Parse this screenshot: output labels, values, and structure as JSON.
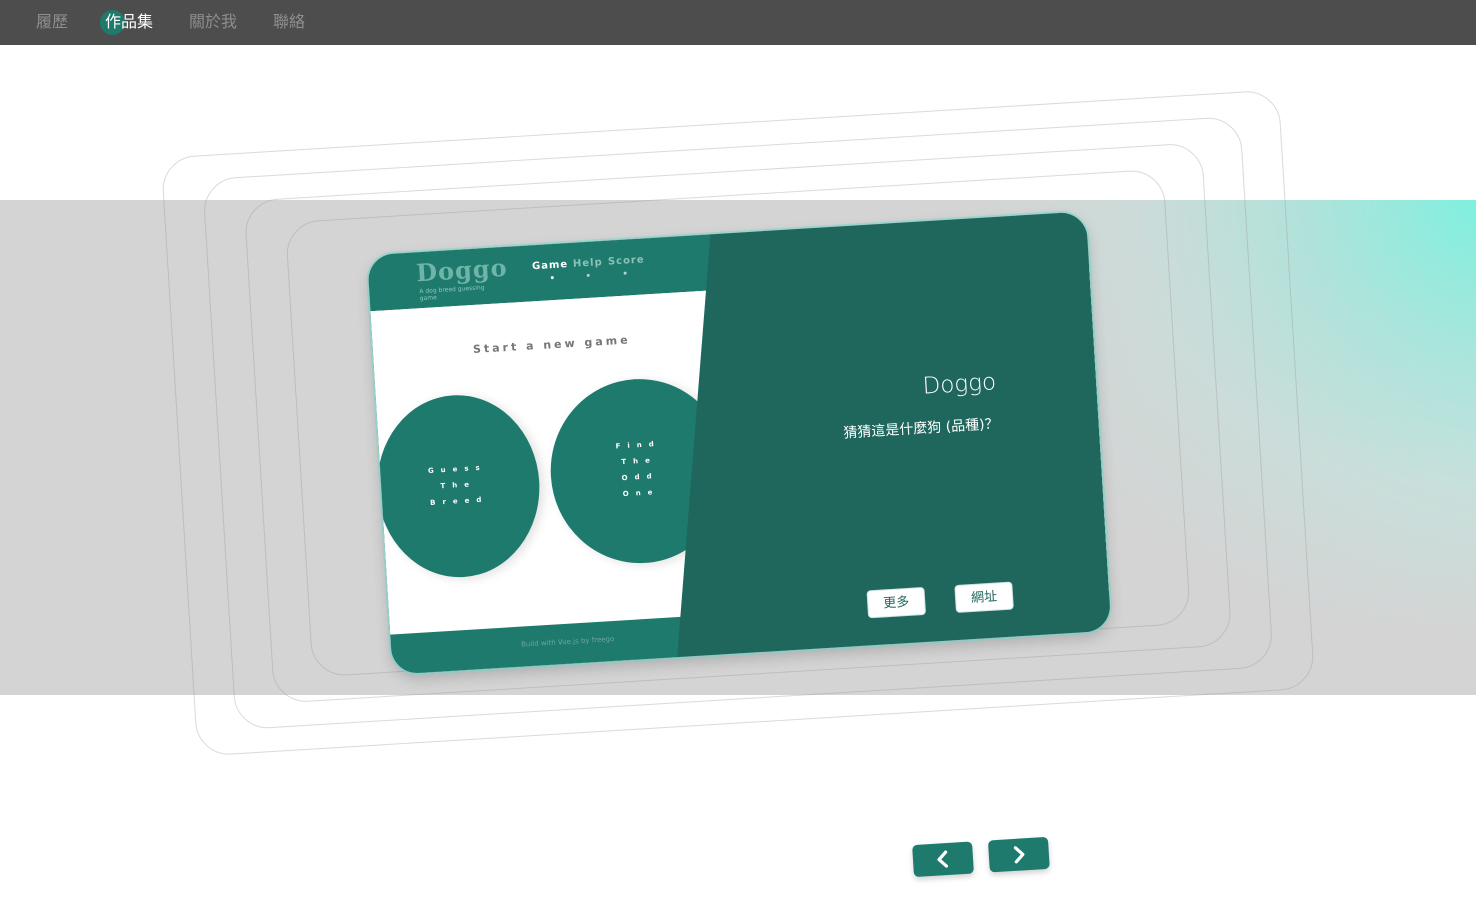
{
  "nav": {
    "items": [
      {
        "label": "履歷"
      },
      {
        "label": "作品集"
      },
      {
        "label": "關於我"
      },
      {
        "label": "聯絡"
      }
    ],
    "active_index": 1
  },
  "project": {
    "title": "Doggo",
    "description": "猜猜這是什麼狗 (品種)？",
    "more_label": "更多",
    "link_label": "網址"
  },
  "preview": {
    "logo": "Doggo",
    "subtitle": "A dog breed guessing game",
    "tabs": [
      "Game",
      "Help",
      "Score"
    ],
    "start_label": "Start a new game",
    "circle_left": [
      "Guess",
      "The",
      "Breed"
    ],
    "circle_right": [
      "Find",
      "The",
      "Odd",
      "One"
    ],
    "footer": "Build with Vue.js by freego"
  },
  "carousel": {
    "prev_icon": "chevron-left-icon",
    "next_icon": "chevron-right-icon"
  },
  "colors": {
    "topbar": "#4d4d4d",
    "accent": "#1f665d",
    "accent_light": "#1e7a6d",
    "band_highlight": "#7ff0df"
  }
}
